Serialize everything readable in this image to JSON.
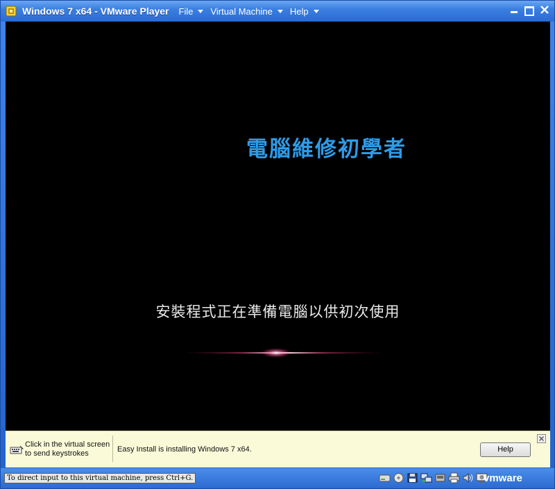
{
  "window": {
    "title": "Windows 7 x64 - VMware Player",
    "accent": "#2a6bd3"
  },
  "menu": {
    "file": "File",
    "virtual_machine": "Virtual Machine",
    "help": "Help"
  },
  "vm_screen": {
    "brand_text": "電腦維修初學者",
    "brand_color": "#2d9be8",
    "status_message": "安裝程式正在準備電腦以供初次使用"
  },
  "infobar": {
    "click_hint_line1": "Click in the virtual screen",
    "click_hint_line2": "to send keystrokes",
    "install_message": "Easy Install is installing Windows 7 x64.",
    "help_button": "Help"
  },
  "statusbar": {
    "input_hint": "To direct input to this virtual machine, press Ctrl+G.",
    "logo": "vmware",
    "device_icons": [
      "hard-disk-icon",
      "cd-dvd-icon",
      "floppy-icon",
      "network-adapter-icon",
      "usb-icon",
      "printer-icon",
      "sound-icon",
      "display-icon"
    ]
  }
}
